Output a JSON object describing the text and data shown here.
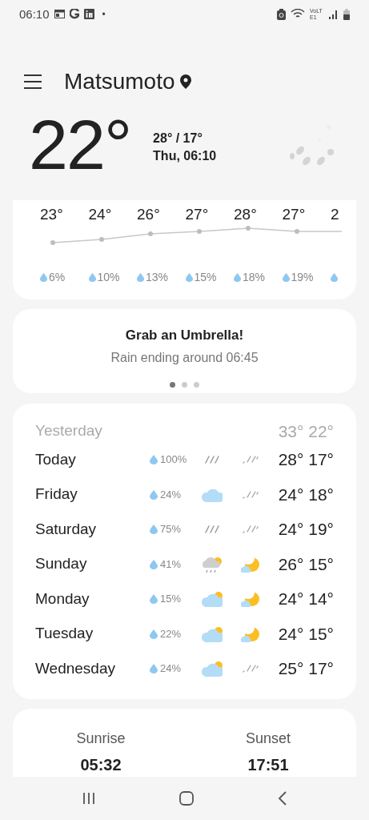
{
  "status_bar": {
    "time": "06:10",
    "dot": "•",
    "network": "VoLTE1"
  },
  "header": {
    "city": "Matsumoto"
  },
  "current": {
    "temp": "22°",
    "high_low": "28° / 17°",
    "date_time": "Thu, 06:10"
  },
  "hourly": [
    {
      "temp": "23°",
      "precip": "6%"
    },
    {
      "temp": "24°",
      "precip": "10%"
    },
    {
      "temp": "26°",
      "precip": "13%"
    },
    {
      "temp": "27°",
      "precip": "15%"
    },
    {
      "temp": "28°",
      "precip": "18%"
    },
    {
      "temp": "27°",
      "precip": "19%"
    },
    {
      "temp": "2"
    }
  ],
  "alert": {
    "title": "Grab an Umbrella!",
    "text": "Rain ending around 06:45",
    "pages": [
      {
        "selected": true
      },
      {
        "selected": false
      },
      {
        "selected": false
      }
    ]
  },
  "daily": {
    "yesterday": {
      "day": "Yesterday",
      "temps": "33° 22°"
    },
    "rows": [
      {
        "day": "Today",
        "precip": "100%",
        "day_icon": {
          "kind": "rain"
        },
        "night_icon": {
          "kind": "drizzle"
        },
        "temps": "28° 17°"
      },
      {
        "day": "Friday",
        "precip": "24%",
        "day_icon": {
          "kind": "cloud"
        },
        "night_icon": {
          "kind": "drizzle"
        },
        "temps": "24° 18°"
      },
      {
        "day": "Saturday",
        "precip": "75%",
        "day_icon": {
          "kind": "rain"
        },
        "night_icon": {
          "kind": "drizzle"
        },
        "temps": "24° 19°"
      },
      {
        "day": "Sunday",
        "precip": "41%",
        "day_icon": {
          "kind": "showers"
        },
        "night_icon": {
          "kind": "moon"
        },
        "temps": "26° 15°"
      },
      {
        "day": "Monday",
        "precip": "15%",
        "day_icon": {
          "kind": "partly"
        },
        "night_icon": {
          "kind": "moon"
        },
        "temps": "24° 14°"
      },
      {
        "day": "Tuesday",
        "precip": "22%",
        "day_icon": {
          "kind": "partly"
        },
        "night_icon": {
          "kind": "moon"
        },
        "temps": "24° 15°"
      },
      {
        "day": "Wednesday",
        "precip": "24%",
        "day_icon": {
          "kind": "partly"
        },
        "night_icon": {
          "kind": "drizzle"
        },
        "temps": "25° 17°"
      }
    ]
  },
  "sun": [
    {
      "label": "Sunrise",
      "time": "05:32"
    },
    {
      "label": "Sunset",
      "time": "17:51"
    }
  ]
}
